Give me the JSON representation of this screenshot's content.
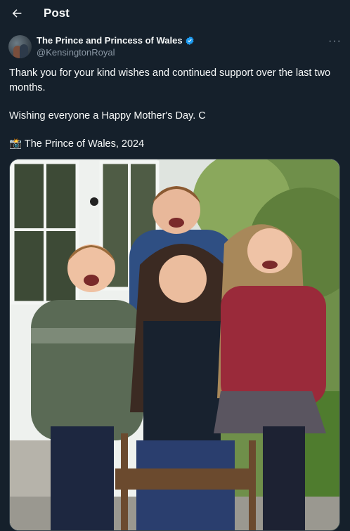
{
  "header": {
    "title": "Post"
  },
  "tweet": {
    "display_name": "The Prince and Princess of Wales",
    "handle": "@KensingtonRoyal",
    "lines": [
      "Thank you for your kind wishes and continued support over the last two months.",
      "Wishing everyone a Happy Mother's Day. C",
      "The Prince of Wales, 2024"
    ],
    "camera_emoji": "📸"
  },
  "icons": {
    "back": "arrow-left-icon",
    "verified": "verified-badge-icon",
    "more": "more-horizontal-icon"
  },
  "colors": {
    "background": "#15202b",
    "text": "#f7f9f9",
    "secondary": "#8b98a5",
    "verified": "#1d9bf0"
  }
}
